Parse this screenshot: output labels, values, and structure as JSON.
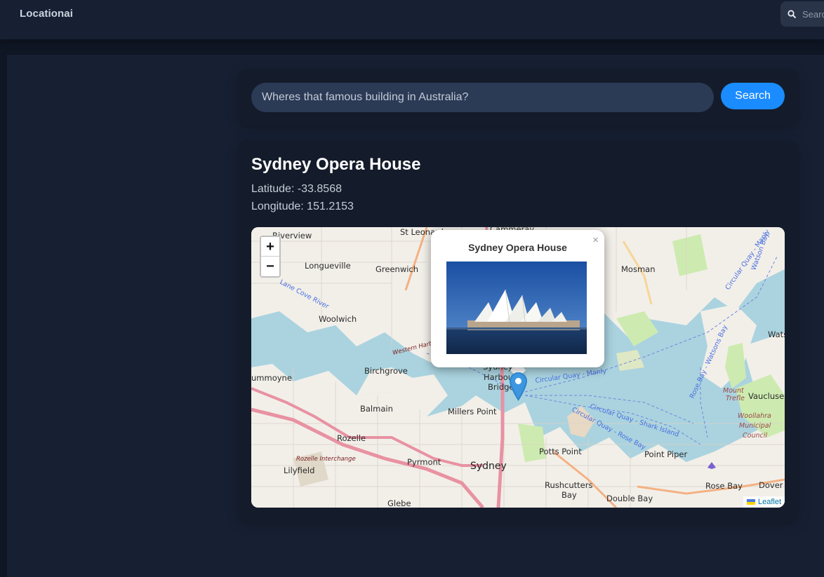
{
  "header": {
    "brand": "Locationai",
    "search_placeholder": "Search"
  },
  "query": {
    "value": "Wheres that famous building in Australia?",
    "button_label": "Search"
  },
  "result": {
    "name": "Sydney Opera House",
    "latitude_text": "Latitude: -33.8568",
    "longitude_text": "Longitude: 151.2153"
  },
  "map": {
    "zoom_in": "+",
    "zoom_out": "−",
    "popup_title": "Sydney Opera House",
    "popup_close": "×",
    "attribution": "Leaflet",
    "place_labels": {
      "riverview": "Riverview",
      "st_leonards": "St Leonards",
      "cammeray": "Cammeray",
      "longueville": "Longueville",
      "greenwich": "Greenwich",
      "mosman": "Mosman",
      "woolwich": "Woolwich",
      "birchgrove": "Birchgrove",
      "drummoyne": "ummoyne",
      "balmain": "Balmain",
      "millers_point": "Millers Point",
      "rozelle": "Rozelle",
      "rozelle_interchange": "Rozelle Interchange",
      "lilyfield": "Lilyfield",
      "pyrmont": "Pyrmont",
      "sydney": "Sydney",
      "potts_point": "Potts Point",
      "rushcutters_bay": "Rushcutters Bay",
      "point_piper": "Point Piper",
      "rose_bay": "Rose Bay",
      "double_bay": "Double Bay",
      "dover": "Dover",
      "vaucluse": "Vaucluse",
      "watsons": "Wats",
      "glebe": "Glebe",
      "mount_trefle": "Mount Trefle",
      "woollahra": "Woollahra Municipal Council",
      "harbour_bridge": "Sydney Harbour Bridge",
      "western_harbour": "Western Harbour",
      "lane_cove_river": "Lane Cove River",
      "circular_quay_manly": "Circular Quay - Manly",
      "circular_quay_shark": "Circular Quay - Shark Island",
      "circular_quay_rose": "Circular Quay - Rose Bay",
      "rose_bay_watsons": "Rose Bay - Watsons Bay",
      "manly_watsons": "Circular Quay - Manly",
      "watson_bay": "Watson Bay"
    }
  },
  "colors": {
    "background": "#0f1624",
    "panel": "#172033",
    "card": "#141c2b",
    "input": "#2b3a55",
    "accent": "#1a8cff",
    "water": "#aad3df",
    "land": "#f2efe9",
    "park": "#cdebb0",
    "motorway": "#e892a2"
  },
  "icons": {
    "top_search": "search-icon",
    "marker": "map-pin-icon",
    "flag": "ukraine-flag-icon"
  }
}
